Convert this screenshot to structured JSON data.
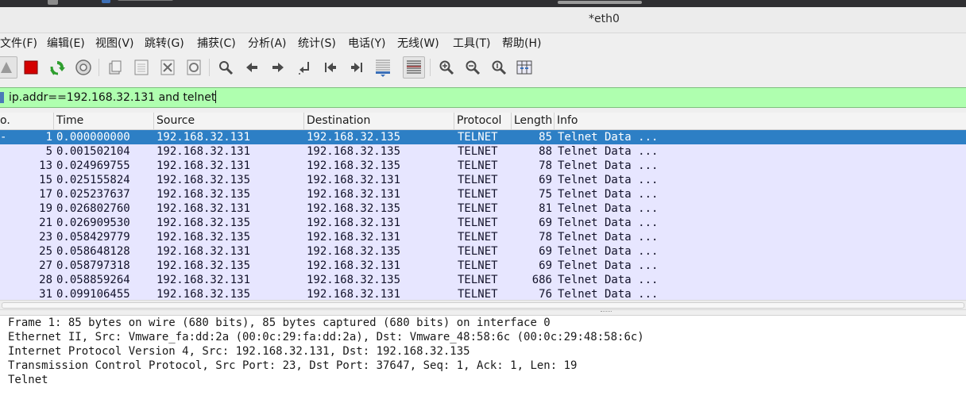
{
  "window": {
    "title": "*eth0"
  },
  "menu": [
    {
      "label": "文件(F)"
    },
    {
      "label": "编辑(E)"
    },
    {
      "label": "视图(V)"
    },
    {
      "label": "跳转(G)"
    },
    {
      "label": "捕获(C)"
    },
    {
      "label": "分析(A)"
    },
    {
      "label": "统计(S)"
    },
    {
      "label": "电话(Y)"
    },
    {
      "label": "无线(W)"
    },
    {
      "label": "工具(T)"
    },
    {
      "label": "帮助(H)"
    }
  ],
  "toolbar": {
    "icons": [
      "start-capture-icon",
      "stop-capture-icon",
      "restart-capture-icon",
      "capture-options-icon",
      "open-file-icon",
      "save-file-icon",
      "close-file-icon",
      "reload-file-icon",
      "find-packet-icon",
      "go-back-icon",
      "go-forward-icon",
      "go-to-packet-icon",
      "first-packet-icon",
      "last-packet-icon",
      "auto-scroll-icon",
      "colorize-icon",
      "zoom-in-icon",
      "zoom-out-icon",
      "normal-size-icon",
      "resize-columns-icon"
    ],
    "colors": {
      "stop": "#d40000",
      "restart": "#2e9e2e",
      "filter_bg": "#afffaf",
      "selected_row": "#2d7fc5",
      "row_bg": "#e7e6ff"
    }
  },
  "filter": {
    "value": "ip.addr==192.168.32.131 and telnet"
  },
  "packet_list": {
    "columns": {
      "no": "o.",
      "time": "Time",
      "source": "Source",
      "destination": "Destination",
      "protocol": "Protocol",
      "length": "Length",
      "info": "Info"
    },
    "selected_marker": "-",
    "rows": [
      {
        "no": "1",
        "time": "0.000000000",
        "src": "192.168.32.131",
        "dst": "192.168.32.135",
        "proto": "TELNET",
        "len": "85",
        "info": "Telnet Data ..."
      },
      {
        "no": "5",
        "time": "0.001502104",
        "src": "192.168.32.131",
        "dst": "192.168.32.135",
        "proto": "TELNET",
        "len": "88",
        "info": "Telnet Data ..."
      },
      {
        "no": "13",
        "time": "0.024969755",
        "src": "192.168.32.131",
        "dst": "192.168.32.135",
        "proto": "TELNET",
        "len": "78",
        "info": "Telnet Data ..."
      },
      {
        "no": "15",
        "time": "0.025155824",
        "src": "192.168.32.135",
        "dst": "192.168.32.131",
        "proto": "TELNET",
        "len": "69",
        "info": "Telnet Data ..."
      },
      {
        "no": "17",
        "time": "0.025237637",
        "src": "192.168.32.135",
        "dst": "192.168.32.131",
        "proto": "TELNET",
        "len": "75",
        "info": "Telnet Data ..."
      },
      {
        "no": "19",
        "time": "0.026802760",
        "src": "192.168.32.131",
        "dst": "192.168.32.135",
        "proto": "TELNET",
        "len": "81",
        "info": "Telnet Data ..."
      },
      {
        "no": "21",
        "time": "0.026909530",
        "src": "192.168.32.135",
        "dst": "192.168.32.131",
        "proto": "TELNET",
        "len": "69",
        "info": "Telnet Data ..."
      },
      {
        "no": "23",
        "time": "0.058429779",
        "src": "192.168.32.135",
        "dst": "192.168.32.131",
        "proto": "TELNET",
        "len": "78",
        "info": "Telnet Data ..."
      },
      {
        "no": "25",
        "time": "0.058648128",
        "src": "192.168.32.131",
        "dst": "192.168.32.135",
        "proto": "TELNET",
        "len": "69",
        "info": "Telnet Data ..."
      },
      {
        "no": "27",
        "time": "0.058797318",
        "src": "192.168.32.135",
        "dst": "192.168.32.131",
        "proto": "TELNET",
        "len": "69",
        "info": "Telnet Data ..."
      },
      {
        "no": "28",
        "time": "0.058859264",
        "src": "192.168.32.131",
        "dst": "192.168.32.135",
        "proto": "TELNET",
        "len": "686",
        "info": "Telnet Data ..."
      },
      {
        "no": "31",
        "time": "0.099106455",
        "src": "192.168.32.135",
        "dst": "192.168.32.131",
        "proto": "TELNET",
        "len": "76",
        "info": "Telnet Data ..."
      }
    ]
  },
  "details": [
    "Frame 1: 85 bytes on wire (680 bits), 85 bytes captured (680 bits) on interface 0",
    "Ethernet II, Src: Vmware_fa:dd:2a (00:0c:29:fa:dd:2a), Dst: Vmware_48:58:6c (00:0c:29:48:58:6c)",
    "Internet Protocol Version 4, Src: 192.168.32.131, Dst: 192.168.32.135",
    "Transmission Control Protocol, Src Port: 23, Dst Port: 37647, Seq: 1, Ack: 1, Len: 19",
    "Telnet"
  ]
}
